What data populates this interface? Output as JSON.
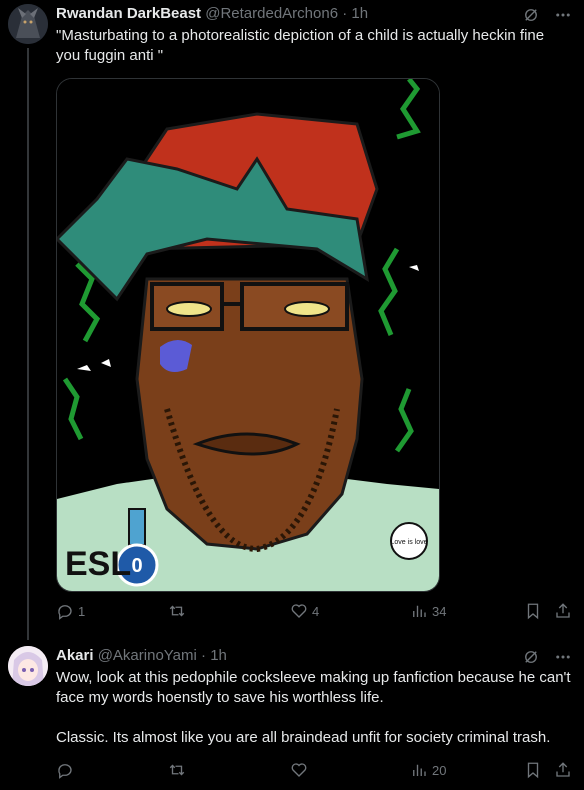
{
  "tweet1": {
    "name": "Rwandan DarkBeast",
    "handle": "@RetardedArchon6",
    "time": "· 1h",
    "text": "\"Masturbating to a photorealistic depiction of a child is actually heckin fine you fuggin anti \"",
    "media": {
      "badge_text": "ESL",
      "medal_text": "0",
      "sticker_text": "Love is love"
    },
    "replies": "1",
    "retweets": "",
    "likes": "4",
    "views": "34"
  },
  "tweet2": {
    "name": "Akari",
    "handle": "@AkarinoYami",
    "time": "· 1h",
    "text_p1": "Wow, look at this pedophile cocksleeve making up fanfiction because he can't face my words hoenstly to save his worthless life.",
    "text_p2": "Classic. Its almost like you are all braindead unfit for society criminal trash.",
    "replies": "",
    "retweets": "",
    "likes": "",
    "views": "20"
  },
  "icons": {
    "grok": "grok-icon",
    "more": "more-icon",
    "reply": "reply-icon",
    "retweet": "retweet-icon",
    "like": "like-icon",
    "views": "views-icon",
    "bookmark": "bookmark-icon",
    "share": "share-icon"
  },
  "colors": {
    "background": "#000000",
    "text": "#e7e9ea",
    "muted": "#71767b",
    "border": "#2f3336"
  }
}
